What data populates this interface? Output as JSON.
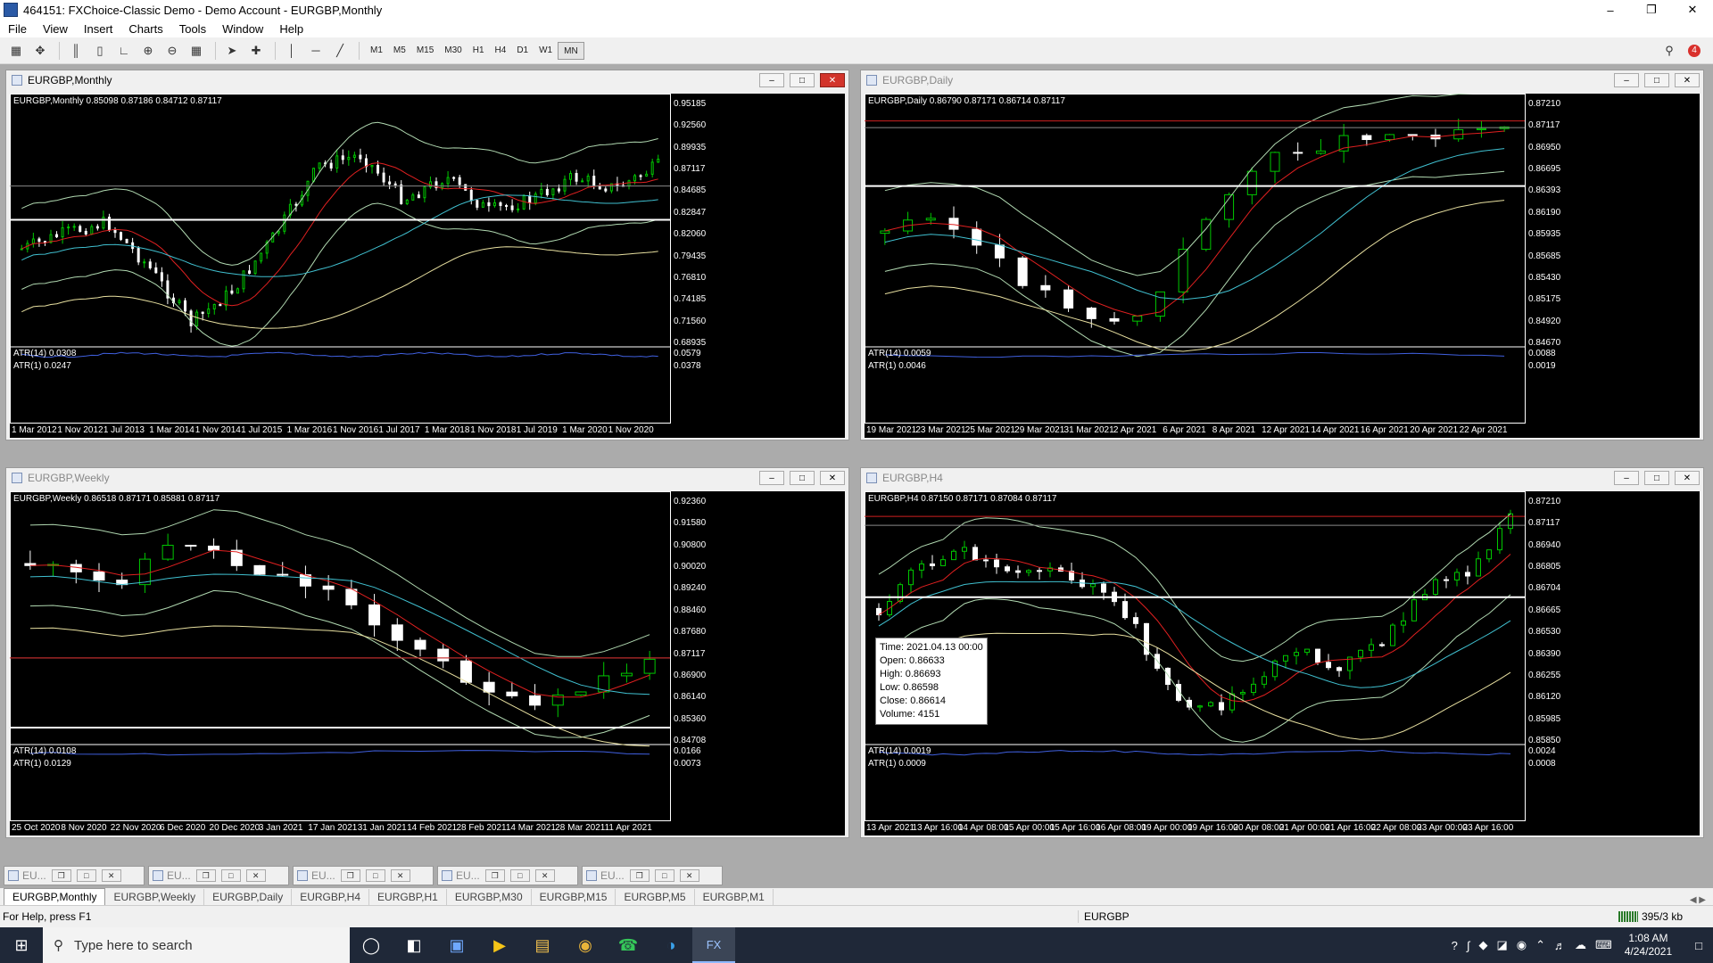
{
  "window": {
    "title": "464151: FXChoice-Classic Demo - Demo Account - EURGBP,Monthly"
  },
  "menu": [
    "File",
    "View",
    "Insert",
    "Charts",
    "Tools",
    "Window",
    "Help"
  ],
  "toolbar": {
    "timeframes": [
      "M1",
      "M5",
      "M15",
      "M30",
      "H1",
      "H4",
      "D1",
      "W1",
      "MN"
    ],
    "active_timeframe": "MN",
    "alert_count": "4"
  },
  "charts": {
    "monthly": {
      "title": "EURGBP,Monthly",
      "info": "EURGBP,Monthly  0.85098 0.87186 0.84712 0.87117",
      "atr14": "ATR(14) 0.0308",
      "atr1": "ATR(1) 0.0247",
      "price_labels": [
        "0.95185",
        "0.92560",
        "0.89935",
        "0.87117",
        "0.84685",
        "0.82847",
        "0.82060",
        "0.79435",
        "0.76810",
        "0.74185",
        "0.71560",
        "0.68935"
      ],
      "atr_labels": [
        "0.0579",
        "0.0378"
      ],
      "date_labels": [
        "1 Mar 2012",
        "1 Nov 2012",
        "1 Jul 2013",
        "1 Mar 2014",
        "1 Nov 2014",
        "1 Jul 2015",
        "1 Mar 2016",
        "1 Nov 2016",
        "1 Jul 2017",
        "1 Mar 2018",
        "1 Nov 2018",
        "1 Jul 2019",
        "1 Mar 2020",
        "1 Nov 2020"
      ]
    },
    "daily": {
      "title": "EURGBP,Daily",
      "info": "EURGBP,Daily  0.86790 0.87171 0.86714 0.87117",
      "atr14": "ATR(14) 0.0059",
      "atr1": "ATR(1) 0.0046",
      "price_labels": [
        "0.87210",
        "0.87117",
        "0.86950",
        "0.86695",
        "0.86393",
        "0.86190",
        "0.85935",
        "0.85685",
        "0.85430",
        "0.85175",
        "0.84920",
        "0.84670"
      ],
      "atr_labels": [
        "0.0088",
        "0.0019"
      ],
      "date_labels": [
        "19 Mar 2021",
        "23 Mar 2021",
        "25 Mar 2021",
        "29 Mar 2021",
        "31 Mar 2021",
        "2 Apr 2021",
        "6 Apr 2021",
        "8 Apr 2021",
        "12 Apr 2021",
        "14 Apr 2021",
        "16 Apr 2021",
        "20 Apr 2021",
        "22 Apr 2021"
      ]
    },
    "weekly": {
      "title": "EURGBP,Weekly",
      "info": "EURGBP,Weekly  0.86518 0.87171 0.85881 0.87117",
      "atr14": "ATR(14) 0.0108",
      "atr1": "ATR(1) 0.0129",
      "price_labels": [
        "0.92360",
        "0.91580",
        "0.90800",
        "0.90020",
        "0.89240",
        "0.88460",
        "0.87680",
        "0.87117",
        "0.86900",
        "0.86140",
        "0.85360",
        "0.84708"
      ],
      "atr_labels": [
        "0.0166",
        "0.0073"
      ],
      "date_labels": [
        "25 Oct 2020",
        "8 Nov 2020",
        "22 Nov 2020",
        "6 Dec 2020",
        "20 Dec 2020",
        "3 Jan 2021",
        "17 Jan 2021",
        "31 Jan 2021",
        "14 Feb 2021",
        "28 Feb 2021",
        "14 Mar 2021",
        "28 Mar 2021",
        "11 Apr 2021"
      ]
    },
    "h4": {
      "title": "EURGBP,H4",
      "info": "EURGBP,H4  0.87150 0.87171 0.87084 0.87117",
      "atr14": "ATR(14) 0.0019",
      "atr1": "ATR(1) 0.0009",
      "price_labels": [
        "0.87210",
        "0.87117",
        "0.86940",
        "0.86805",
        "0.86704",
        "0.86665",
        "0.86530",
        "0.86390",
        "0.86255",
        "0.86120",
        "0.85985",
        "0.85850"
      ],
      "atr_labels": [
        "0.0024",
        "0.0008"
      ],
      "date_labels": [
        "13 Apr 2021",
        "13 Apr 16:00",
        "14 Apr 08:00",
        "15 Apr 00:00",
        "15 Apr 16:00",
        "16 Apr 08:00",
        "19 Apr 00:00",
        "19 Apr 16:00",
        "20 Apr 08:00",
        "21 Apr 00:00",
        "21 Apr 16:00",
        "22 Apr 08:00",
        "23 Apr 00:00",
        "23 Apr 16:00"
      ],
      "tooltip": {
        "time": "Time: 2021.04.13 00:00",
        "open": "Open: 0.86633",
        "high": "High: 0.86693",
        "low": "Low: 0.86598",
        "close": "Close: 0.86614",
        "volume": "Volume: 4151"
      }
    }
  },
  "minimized": [
    "EU...",
    "EU...",
    "EU...",
    "EU...",
    "EU..."
  ],
  "tabs": [
    "EURGBP,Monthly",
    "EURGBP,Weekly",
    "EURGBP,Daily",
    "EURGBP,H4",
    "EURGBP,H1",
    "EURGBP,M30",
    "EURGBP,M15",
    "EURGBP,M5",
    "EURGBP,M1"
  ],
  "status": {
    "help": "For Help, press F1",
    "symbol": "EURGBP",
    "traffic": "395/3 kb"
  },
  "taskbar": {
    "search_placeholder": "Type here to search",
    "time": "1:08 AM",
    "date": "4/24/2021"
  },
  "colors": {
    "bull": "#00c800",
    "bear": "#ffffff",
    "ma_red": "#e02020",
    "bb": "#b0d8b0",
    "ma_cyan": "#40c0d0",
    "ma_yellow": "#e8e0a0"
  }
}
